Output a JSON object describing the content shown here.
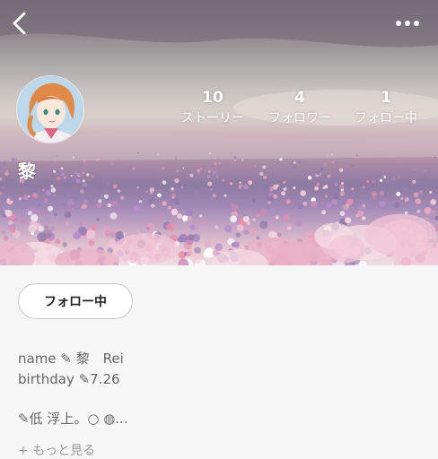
{
  "header": {
    "back_icon": "chevron-left-icon",
    "more_icon": "ellipsis-icon"
  },
  "profile": {
    "name": "黎",
    "avatar": "avatar-anime-character",
    "stats": [
      {
        "value": "10",
        "label": "ストーリー"
      },
      {
        "value": "4",
        "label": "フォロワー"
      },
      {
        "value": "1",
        "label": "フォロー中"
      }
    ],
    "follow_button_label": "フォロー中"
  },
  "bio": {
    "lines": [
      "name ✎ 黎　Rei",
      "birthday ✎7.26",
      "✎低 浮上。○ ◍..."
    ],
    "more_label": "+ もっと見る"
  },
  "colors": {
    "cover_sky": "#a7a2a3",
    "flowers_pink": "#e6a6c0",
    "flowers_purple": "#8e7aa2",
    "page_background": "#f6f6f6",
    "text_muted": "#666666"
  }
}
